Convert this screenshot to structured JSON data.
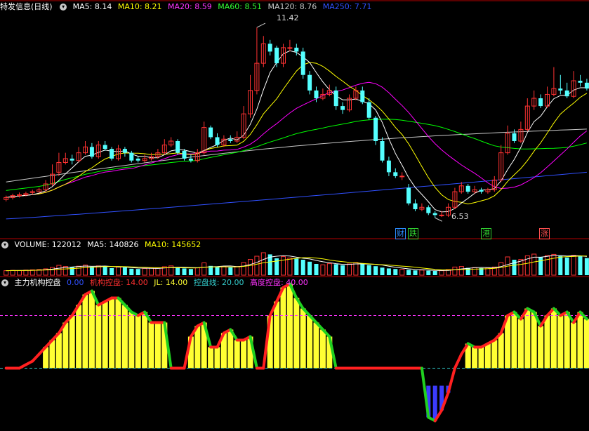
{
  "colors": {
    "up": "#ff3232",
    "down": "#54ffff",
    "ma5": "#ffffff",
    "ma10": "#ffff00",
    "ma20": "#ff00ff",
    "ma60": "#00ff00",
    "ma120": "#c8c8c8",
    "ma250": "#3050ff",
    "grid": "#b40000",
    "bull": "#ff2020",
    "bear": "#20d020",
    "bar": "#ffff33",
    "bottom_bar": "#3c3cff",
    "jl_line": "#ff33ff",
    "kpx_line": "#33cccc"
  },
  "price_panel": {
    "title": "特发信息(日线)",
    "ma5": {
      "label": "MA5:",
      "value": "8.14"
    },
    "ma10": {
      "label": "MA10:",
      "value": "8.21"
    },
    "ma20": {
      "label": "MA20:",
      "value": "8.59"
    },
    "ma60": {
      "label": "MA60:",
      "value": "8.51"
    },
    "ma120": {
      "label": "MA120:",
      "value": "8.76"
    },
    "ma250": {
      "label": "MA250:",
      "value": "7.71"
    },
    "high_label": "11.42",
    "low_label": "6.53",
    "event_tags": [
      {
        "text": "财",
        "icon": "finance-tag-icon",
        "color": "#2a8cff"
      },
      {
        "text": "跌",
        "icon": "fall-tag-icon",
        "color": "#30d030"
      },
      {
        "text": "港",
        "icon": "hk-connect-tag-icon",
        "color": "#30d030"
      },
      {
        "text": "涨",
        "icon": "rise-tag-icon",
        "color": "#ff5050"
      }
    ]
  },
  "volume_panel": {
    "title": "VOLUME:",
    "volume_value": "122012",
    "ma5": {
      "label": "MA5:",
      "value": "140826"
    },
    "ma10": {
      "label": "MA10:",
      "value": "145652"
    }
  },
  "indicator_panel": {
    "title": "主力机构控盘",
    "zero": {
      "value": "0.00"
    },
    "jgkp": {
      "label": "机构控盘:",
      "value": "14.00"
    },
    "jl": {
      "label": "JL:",
      "value": "14.00"
    },
    "kpx": {
      "label": "控盘线:",
      "value": "20.00"
    },
    "gdkp": {
      "label": "高度控盘:",
      "value": "40.00"
    }
  },
  "chart_data": [
    {
      "type": "candlestick",
      "title": "特发信息(日线)",
      "annotations": [
        {
          "text": "11.42",
          "kind": "max"
        },
        {
          "text": "6.53",
          "kind": "min"
        }
      ],
      "ylim": [
        6.3,
        11.8
      ],
      "series_close": [
        7.05,
        7.1,
        7.12,
        7.15,
        7.2,
        7.25,
        7.4,
        7.65,
        7.95,
        8.05,
        8.0,
        8.2,
        8.35,
        8.1,
        8.4,
        8.3,
        8.05,
        8.3,
        8.2,
        8.0,
        8.0,
        8.05,
        8.1,
        8.2,
        8.4,
        8.5,
        8.2,
        8.05,
        8.0,
        8.2,
        8.85,
        8.6,
        8.4,
        8.55,
        8.5,
        8.6,
        9.2,
        9.8,
        10.5,
        11.0,
        10.8,
        10.5,
        10.9,
        10.9,
        10.8,
        10.2,
        9.8,
        9.6,
        9.7,
        9.8,
        9.4,
        9.3,
        9.6,
        9.8,
        9.5,
        9.1,
        8.5,
        8.0,
        7.7,
        7.6,
        7.6,
        6.9,
        6.75,
        6.8,
        6.65,
        6.6,
        6.6,
        6.8,
        7.2,
        7.35,
        7.2,
        7.25,
        7.2,
        7.25,
        7.5,
        8.2,
        8.7,
        8.5,
        8.8,
        9.4,
        9.6,
        9.4,
        9.7,
        9.85,
        9.8,
        9.65,
        10.05,
        10.0,
        9.85
      ],
      "series_open": [
        7.0,
        7.05,
        7.1,
        7.12,
        7.18,
        7.2,
        7.25,
        7.4,
        7.7,
        7.95,
        8.05,
        8.0,
        8.2,
        8.35,
        8.1,
        8.4,
        8.3,
        8.05,
        8.3,
        8.2,
        8.05,
        8.0,
        8.05,
        8.1,
        8.2,
        8.4,
        8.5,
        8.25,
        8.05,
        8.0,
        8.2,
        8.85,
        8.6,
        8.4,
        8.55,
        8.5,
        8.6,
        9.2,
        9.8,
        10.5,
        11.0,
        10.9,
        10.5,
        10.9,
        10.9,
        10.8,
        10.2,
        9.8,
        9.6,
        9.7,
        9.8,
        9.4,
        9.3,
        9.6,
        9.8,
        9.5,
        9.1,
        8.5,
        8.0,
        7.7,
        7.6,
        7.3,
        6.9,
        6.75,
        6.8,
        6.65,
        6.6,
        6.6,
        6.8,
        7.2,
        7.35,
        7.2,
        7.25,
        7.2,
        7.25,
        7.5,
        8.2,
        8.7,
        8.5,
        8.8,
        9.4,
        9.6,
        9.4,
        9.7,
        9.85,
        9.8,
        9.65,
        10.05,
        10.0
      ],
      "series_high": [
        7.1,
        7.15,
        7.18,
        7.2,
        7.25,
        7.3,
        7.5,
        7.9,
        8.2,
        8.2,
        8.15,
        8.35,
        8.5,
        8.45,
        8.5,
        8.5,
        8.35,
        8.4,
        8.35,
        8.25,
        8.1,
        8.15,
        8.2,
        8.3,
        8.55,
        8.6,
        8.55,
        8.3,
        8.15,
        8.3,
        9.0,
        8.9,
        8.7,
        8.65,
        8.65,
        8.75,
        9.4,
        10.2,
        11.42,
        11.2,
        11.1,
        10.95,
        11.0,
        11.1,
        11.0,
        10.9,
        10.3,
        9.9,
        9.85,
        9.95,
        9.9,
        9.5,
        9.7,
        9.9,
        9.9,
        9.6,
        9.15,
        8.6,
        8.1,
        7.8,
        7.7,
        7.4,
        7.0,
        6.9,
        6.85,
        6.7,
        6.7,
        6.9,
        7.3,
        7.45,
        7.4,
        7.35,
        7.3,
        7.3,
        7.6,
        8.4,
        8.9,
        8.8,
        9.0,
        9.6,
        9.8,
        9.7,
        9.9,
        10.4,
        10.2,
        10.0,
        10.3,
        10.2,
        10.1
      ],
      "series_low": [
        6.95,
        7.0,
        7.05,
        7.08,
        7.12,
        7.18,
        7.2,
        7.35,
        7.6,
        7.9,
        7.9,
        7.95,
        8.15,
        8.05,
        8.05,
        8.25,
        8.0,
        8.0,
        8.1,
        7.95,
        7.95,
        7.95,
        8.0,
        8.05,
        8.15,
        8.35,
        8.15,
        8.0,
        7.95,
        7.95,
        8.15,
        8.55,
        8.35,
        8.35,
        8.45,
        8.45,
        8.55,
        9.1,
        9.7,
        10.4,
        10.7,
        10.4,
        10.4,
        10.8,
        10.7,
        10.1,
        9.7,
        9.5,
        9.55,
        9.65,
        9.3,
        9.2,
        9.25,
        9.55,
        9.45,
        9.05,
        8.4,
        7.95,
        7.6,
        7.55,
        7.5,
        6.85,
        6.7,
        6.7,
        6.6,
        6.53,
        6.55,
        6.55,
        6.75,
        7.15,
        7.15,
        7.15,
        7.15,
        7.15,
        7.2,
        7.45,
        8.15,
        8.45,
        8.45,
        8.75,
        9.3,
        9.35,
        9.35,
        9.65,
        9.7,
        9.6,
        9.6,
        9.9,
        9.8
      ],
      "moving_averages": [
        "MA5",
        "MA10",
        "MA20",
        "MA60",
        "MA120",
        "MA250"
      ]
    },
    {
      "type": "bar",
      "title": "VOLUME",
      "values": [
        32,
        34,
        33,
        36,
        38,
        40,
        45,
        55,
        70,
        62,
        58,
        64,
        72,
        60,
        66,
        62,
        50,
        58,
        55,
        46,
        44,
        48,
        50,
        52,
        60,
        66,
        54,
        48,
        44,
        52,
        88,
        66,
        58,
        60,
        56,
        62,
        90,
        112,
        135,
        160,
        148,
        120,
        132,
        122,
        118,
        110,
        96,
        80,
        74,
        82,
        78,
        70,
        80,
        90,
        82,
        72,
        64,
        54,
        48,
        44,
        42,
        38,
        34,
        36,
        32,
        30,
        32,
        40,
        58,
        62,
        52,
        54,
        50,
        52,
        58,
        90,
        130,
        110,
        112,
        138,
        150,
        130,
        140,
        148,
        136,
        126,
        142,
        138,
        122
      ],
      "series": [
        {
          "name": "MA5"
        },
        {
          "name": "MA10"
        }
      ]
    },
    {
      "type": "bar",
      "title": "主力机构控盘",
      "ylim": [
        -25,
        55
      ],
      "values": [
        10,
        10,
        10,
        12,
        14,
        18,
        22,
        26,
        30,
        36,
        40,
        46,
        52,
        54,
        46,
        48,
        50,
        50,
        46,
        42,
        40,
        42,
        36,
        36,
        36,
        10,
        10,
        10,
        28,
        34,
        36,
        22,
        22,
        30,
        32,
        26,
        26,
        28,
        10,
        10,
        40,
        48,
        56,
        58,
        50,
        44,
        40,
        36,
        32,
        28,
        10,
        10,
        10,
        10,
        10,
        10,
        10,
        10,
        10,
        10,
        10,
        10,
        10,
        10,
        -18,
        -20,
        -14,
        -4,
        10,
        18,
        24,
        22,
        22,
        24,
        26,
        30,
        40,
        42,
        38,
        44,
        42,
        34,
        40,
        44,
        40,
        42,
        36,
        42,
        38
      ],
      "lines": [
        {
          "name": "JL",
          "value": 14.0
        },
        {
          "name": "控盘线",
          "value": 20.0
        },
        {
          "name": "高度控盘",
          "value": 40.0
        }
      ]
    }
  ]
}
